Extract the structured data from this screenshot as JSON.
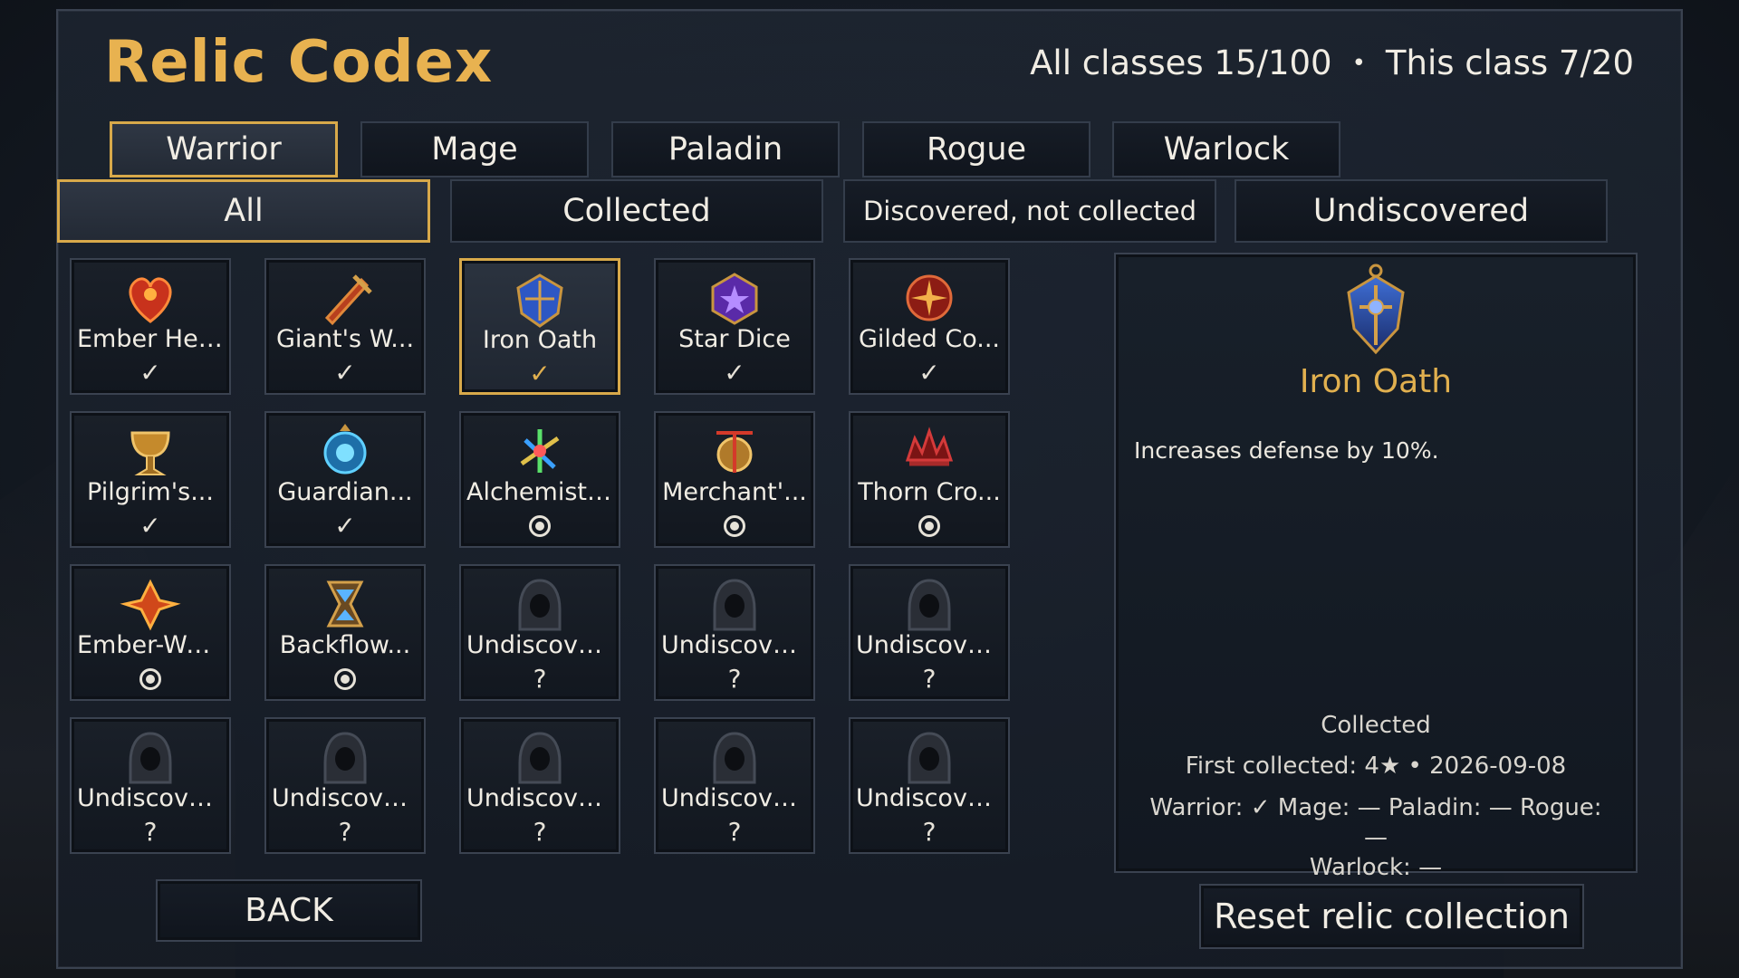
{
  "header": {
    "title": "Relic Codex",
    "progress_all": "All classes 15/100",
    "progress_separator": "•",
    "progress_class": "This class 7/20"
  },
  "class_tabs": [
    {
      "label": "Warrior",
      "active": true
    },
    {
      "label": "Mage",
      "active": false
    },
    {
      "label": "Paladin",
      "active": false
    },
    {
      "label": "Rogue",
      "active": false
    },
    {
      "label": "Warlock",
      "active": false
    }
  ],
  "filter_tabs": [
    {
      "label": "All",
      "active": true
    },
    {
      "label": "Collected",
      "active": false
    },
    {
      "label": "Discovered, not collected",
      "active": false
    },
    {
      "label": "Undiscovered",
      "active": false
    }
  ],
  "status_symbols": {
    "collected": "✓",
    "discovered": "radio-icon",
    "undiscovered": "?"
  },
  "relics": [
    {
      "name": "Ember Heart",
      "status": "collected",
      "icon": "ember-heart-icon"
    },
    {
      "name": "Giant's W...",
      "status": "collected",
      "icon": "giants-weapon-icon"
    },
    {
      "name": "Iron Oath",
      "status": "collected",
      "icon": "iron-oath-icon",
      "selected": true
    },
    {
      "name": "Star Dice",
      "status": "collected",
      "icon": "star-dice-icon"
    },
    {
      "name": "Gilded Co...",
      "status": "collected",
      "icon": "gilded-compass-icon"
    },
    {
      "name": "Pilgrim's...",
      "status": "collected",
      "icon": "pilgrims-chalice-icon"
    },
    {
      "name": "Guardian...",
      "status": "collected",
      "icon": "guardian-orb-icon"
    },
    {
      "name": "Alchemist'...",
      "status": "discovered",
      "icon": "alchemist-icon"
    },
    {
      "name": "Merchant'...",
      "status": "discovered",
      "icon": "merchant-scale-icon"
    },
    {
      "name": "Thorn Cro...",
      "status": "discovered",
      "icon": "thorn-crown-icon"
    },
    {
      "name": "Ember-We...",
      "status": "discovered",
      "icon": "ember-weave-icon"
    },
    {
      "name": "Backflow...",
      "status": "discovered",
      "icon": "backflow-hourglass-icon"
    },
    {
      "name": "Undiscove...",
      "status": "undiscovered",
      "icon": "hooded-silhouette-icon"
    },
    {
      "name": "Undiscove...",
      "status": "undiscovered",
      "icon": "hooded-silhouette-icon"
    },
    {
      "name": "Undiscove...",
      "status": "undiscovered",
      "icon": "hooded-silhouette-icon"
    },
    {
      "name": "Undiscove...",
      "status": "undiscovered",
      "icon": "hooded-silhouette-icon"
    },
    {
      "name": "Undiscove...",
      "status": "undiscovered",
      "icon": "hooded-silhouette-icon"
    },
    {
      "name": "Undiscove...",
      "status": "undiscovered",
      "icon": "hooded-silhouette-icon"
    },
    {
      "name": "Undiscove...",
      "status": "undiscovered",
      "icon": "hooded-silhouette-icon"
    },
    {
      "name": "Undiscove...",
      "status": "undiscovered",
      "icon": "hooded-silhouette-icon"
    }
  ],
  "detail": {
    "icon": "iron-oath-icon",
    "name": "Iron Oath",
    "description": "Increases defense by 10%.",
    "collected_label": "Collected",
    "first_collected": "First collected: 4★ • 2026-09-08",
    "class_status_line1": "Warrior: ✓ Mage: — Paladin: — Rogue: —",
    "class_status_line2": "Warlock: —"
  },
  "buttons": {
    "back": "BACK",
    "reset": "Reset relic collection"
  },
  "colors": {
    "gold_accent": "#d8a94a",
    "title_gold": "#e8b250",
    "panel_border": "#3a4250",
    "panel_bg": "#161c26"
  }
}
